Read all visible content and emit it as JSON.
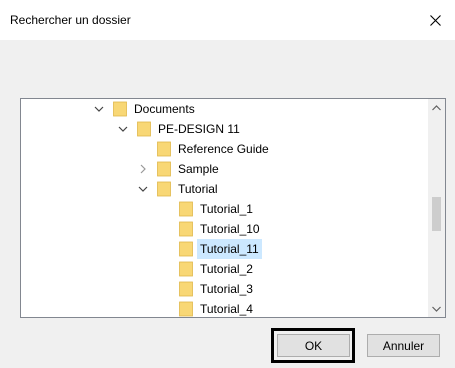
{
  "dialog": {
    "title": "Rechercher un dossier",
    "close_glyph": "close-icon"
  },
  "tree": {
    "items": [
      {
        "label": "Documents",
        "expander": "expanded",
        "selected": false
      },
      {
        "label": "PE-DESIGN 11",
        "expander": "expanded",
        "selected": false
      },
      {
        "label": "Reference Guide",
        "expander": "none",
        "selected": false
      },
      {
        "label": "Sample",
        "expander": "collapsed",
        "selected": false
      },
      {
        "label": "Tutorial",
        "expander": "expanded",
        "selected": false
      },
      {
        "label": "Tutorial_1",
        "expander": "none",
        "selected": false
      },
      {
        "label": "Tutorial_10",
        "expander": "none",
        "selected": false
      },
      {
        "label": "Tutorial_11",
        "expander": "none",
        "selected": true
      },
      {
        "label": "Tutorial_2",
        "expander": "none",
        "selected": false
      },
      {
        "label": "Tutorial_3",
        "expander": "none",
        "selected": false
      },
      {
        "label": "Tutorial_4",
        "expander": "none",
        "selected": false
      }
    ],
    "scrollbar": {
      "up_icon": "scroll-up-icon",
      "down_icon": "scroll-down-icon"
    }
  },
  "buttons": {
    "ok_label": "OK",
    "cancel_label": "Annuler"
  },
  "colors": {
    "folder": "#f8d775",
    "selection": "#cce8ff",
    "tree_border": "#828790",
    "window_bg": "#f0f0f0"
  }
}
